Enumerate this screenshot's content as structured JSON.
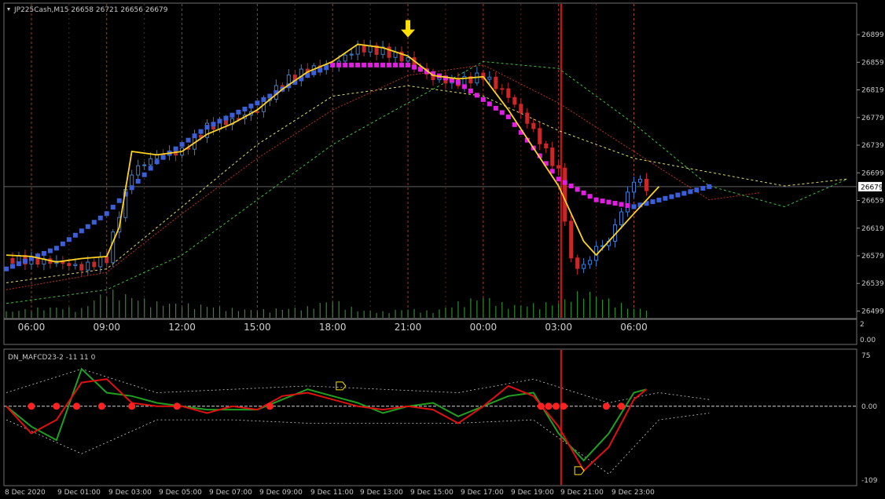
{
  "header": {
    "symbol_line": "JP225Cash,M15  26658 26721 26656 26679",
    "indicator_label": "DN_MAFCD23-2 -11 11 0"
  },
  "colors": {
    "background": "#000000",
    "bull_candle": "#3c7fd0",
    "bear_candle": "#c82828",
    "up_trend": "#3a5fd8",
    "down_trend": "#e020e0",
    "fast_ma": "#ffd21e",
    "current_time_line": "#e01010",
    "grid_separator": "#a03c28",
    "volume": "#2e8b2e",
    "osc_fast": "#e01010",
    "osc_slow": "#20a020",
    "osc_signal_dot": "#ff2020",
    "band": "#c8c8c8"
  },
  "chart_data": [
    {
      "type": "candlestick",
      "title": "JP225Cash,M15",
      "ohlc_readout": {
        "open": 26658,
        "high": 26721,
        "low": 26656,
        "close": 26679
      },
      "current_price": 26679,
      "y_ticks": [
        26899,
        26859,
        26819,
        26779,
        26739,
        26699,
        26659,
        26619,
        26579,
        26539,
        26499
      ],
      "ylim": [
        26495,
        26915
      ],
      "x_tick_labels": [
        "06:00",
        "09:00",
        "12:00",
        "15:00",
        "18:00",
        "21:00",
        "00:00",
        "03:00",
        "06:00"
      ],
      "x_tick_hours": [
        6,
        9,
        12,
        15,
        18,
        21,
        24,
        27,
        30
      ],
      "price_path_keypoints": {
        "hours": [
          5.0,
          6.0,
          7.0,
          8.0,
          9.0,
          9.5,
          10.0,
          11.0,
          12.0,
          13.0,
          14.0,
          15.0,
          16.0,
          17.0,
          18.0,
          19.0,
          20.0,
          21.0,
          22.0,
          23.0,
          24.0,
          25.0,
          26.0,
          27.0,
          27.5,
          28.0,
          28.5,
          29.0,
          30.0,
          30.5
        ],
        "close": [
          26575,
          26572,
          26570,
          26562,
          26575,
          26640,
          26700,
          26725,
          26730,
          26765,
          26775,
          26790,
          26830,
          26848,
          26855,
          26880,
          26875,
          26862,
          26835,
          26830,
          26840,
          26810,
          26760,
          26700,
          26570,
          26562,
          26590,
          26600,
          26690,
          26679
        ]
      },
      "up_trend_line": {
        "hours": [
          5.0,
          7.0,
          9.0,
          11.0,
          13.0,
          15.0,
          17.0,
          18.0
        ],
        "values": [
          26560,
          26590,
          26640,
          26715,
          26765,
          26800,
          26840,
          26855
        ]
      },
      "down_trend_line": {
        "hours": [
          18.0,
          21.0,
          23.0,
          25.0,
          27.0,
          28.5,
          30.0
        ],
        "values": [
          26855,
          26855,
          26830,
          26780,
          26690,
          26660,
          26650
        ]
      },
      "up_trend_tail": {
        "hours": [
          30.0,
          33.0
        ],
        "values": [
          26650,
          26679
        ]
      },
      "fast_ma": {
        "hours": [
          5.0,
          6.0,
          7.0,
          8.0,
          9.0,
          9.5,
          10.0,
          11.0,
          12.0,
          13.0,
          14.0,
          15.0,
          16.0,
          17.0,
          18.0,
          19.0,
          20.0,
          21.0,
          22.0,
          23.0,
          24.0,
          25.0,
          26.0,
          27.0,
          28.0,
          28.5,
          29.0,
          30.0,
          31.0
        ],
        "values": [
          26580,
          26578,
          26570,
          26575,
          26578,
          26620,
          26730,
          26725,
          26730,
          26755,
          26770,
          26790,
          26820,
          26845,
          26860,
          26885,
          26880,
          26868,
          26840,
          26835,
          26838,
          26790,
          26735,
          26680,
          26600,
          26580,
          26600,
          26640,
          26679
        ]
      },
      "slow_ma_1": {
        "hours": [
          5.0,
          9.0,
          12.0,
          15.0,
          18.0,
          21.0,
          24.0,
          27.0,
          30.0,
          33.0,
          36.0,
          38.5
        ],
        "values": [
          26540,
          26560,
          26650,
          26740,
          26810,
          26825,
          26810,
          26760,
          26720,
          26700,
          26680,
          26690
        ]
      },
      "slow_ma_2": {
        "hours": [
          5.0,
          9.0,
          12.0,
          15.0,
          18.0,
          21.0,
          24.0,
          27.0,
          30.0,
          33.0,
          35.0
        ],
        "values": [
          26530,
          26555,
          26640,
          26720,
          26790,
          26840,
          26855,
          26800,
          26730,
          26660,
          26670
        ]
      },
      "slow_ma_3": {
        "hours": [
          5.0,
          9.0,
          12.0,
          15.0,
          18.0,
          21.0,
          24.0,
          27.0,
          30.0,
          33.0,
          36.0,
          38.5
        ],
        "values": [
          26510,
          26530,
          26580,
          26660,
          26740,
          26800,
          26860,
          26850,
          26770,
          26680,
          26650,
          26690
        ]
      },
      "volume_hours": [
        5.0,
        6.0,
        7.0,
        8.0,
        9.0,
        10.0,
        11.0,
        12.0,
        13.0,
        14.0,
        15.0,
        16.0,
        17.0,
        18.0,
        19.0,
        20.0,
        21.0,
        22.0,
        23.0,
        24.0,
        25.0,
        26.0,
        27.0,
        28.0,
        29.0,
        30.0
      ],
      "volume_values": [
        4,
        6,
        7,
        6,
        18,
        14,
        10,
        9,
        8,
        6,
        5,
        6,
        7,
        12,
        5,
        4,
        6,
        4,
        10,
        14,
        8,
        9,
        10,
        18,
        12,
        6
      ]
    },
    {
      "type": "line",
      "title": "DN_MAFCD23-2 -11 11 0",
      "y_ticks": [
        75,
        0.0,
        -109
      ],
      "ylim": [
        -109,
        75
      ],
      "x_tick_labels": [
        "8 Dec 2020",
        "9 Dec 01:00",
        "9 Dec 03:00",
        "9 Dec 05:00",
        "9 Dec 07:00",
        "9 Dec 09:00",
        "9 Dec 11:00",
        "9 Dec 13:00",
        "9 Dec 15:00",
        "9 Dec 17:00",
        "9 Dec 19:00",
        "9 Dec 21:00",
        "9 Dec 23:00"
      ],
      "series": [
        {
          "name": "",
          "hours": [
            5.0,
            6.0,
            7.0,
            8.0,
            9.0,
            10.0,
            11.0,
            12.0,
            13.0,
            14.0,
            15.0,
            16.0,
            17.0,
            18.0,
            19.0,
            20.0,
            21.0,
            22.0,
            23.0,
            24.0,
            25.0,
            26.0,
            27.0,
            28.0,
            29.0,
            30.0,
            30.5
          ],
          "values": [
            0,
            -40,
            -20,
            35,
            40,
            5,
            0,
            0,
            -10,
            0,
            -5,
            15,
            20,
            10,
            0,
            -5,
            0,
            -5,
            -25,
            0,
            30,
            15,
            -30,
            -95,
            -60,
            10,
            25
          ]
        },
        {
          "name": "",
          "hours": [
            5.0,
            6.0,
            7.0,
            8.0,
            9.0,
            10.0,
            11.0,
            12.0,
            13.0,
            14.0,
            15.0,
            16.0,
            17.0,
            18.0,
            19.0,
            20.0,
            21.0,
            22.0,
            23.0,
            24.0,
            25.0,
            26.0,
            27.0,
            28.0,
            29.0,
            30.0,
            30.5
          ],
          "values": [
            0,
            -30,
            -50,
            55,
            20,
            15,
            5,
            0,
            -5,
            -5,
            -5,
            10,
            25,
            15,
            5,
            -10,
            0,
            5,
            -15,
            0,
            15,
            20,
            -40,
            -80,
            -40,
            20,
            25
          ]
        }
      ],
      "band_upper_hours": [
        5.0,
        8.0,
        11.0,
        14.0,
        17.0,
        20.0,
        23.0,
        26.0,
        29.0,
        31.0,
        33.0
      ],
      "band_upper": [
        20,
        55,
        20,
        25,
        30,
        25,
        20,
        40,
        5,
        20,
        10
      ],
      "band_lower_hours": [
        5.0,
        8.0,
        11.0,
        14.0,
        17.0,
        20.0,
        23.0,
        26.0,
        29.0,
        31.0,
        33.0
      ],
      "band_lower": [
        -20,
        -70,
        -20,
        -20,
        -25,
        -25,
        -25,
        -20,
        -100,
        -20,
        -10
      ],
      "signal_dot_hours": [
        6.0,
        7.0,
        7.8,
        8.8,
        10.0,
        11.8,
        15.5,
        26.3,
        26.6,
        26.9,
        27.2,
        28.9,
        29.5
      ]
    }
  ]
}
